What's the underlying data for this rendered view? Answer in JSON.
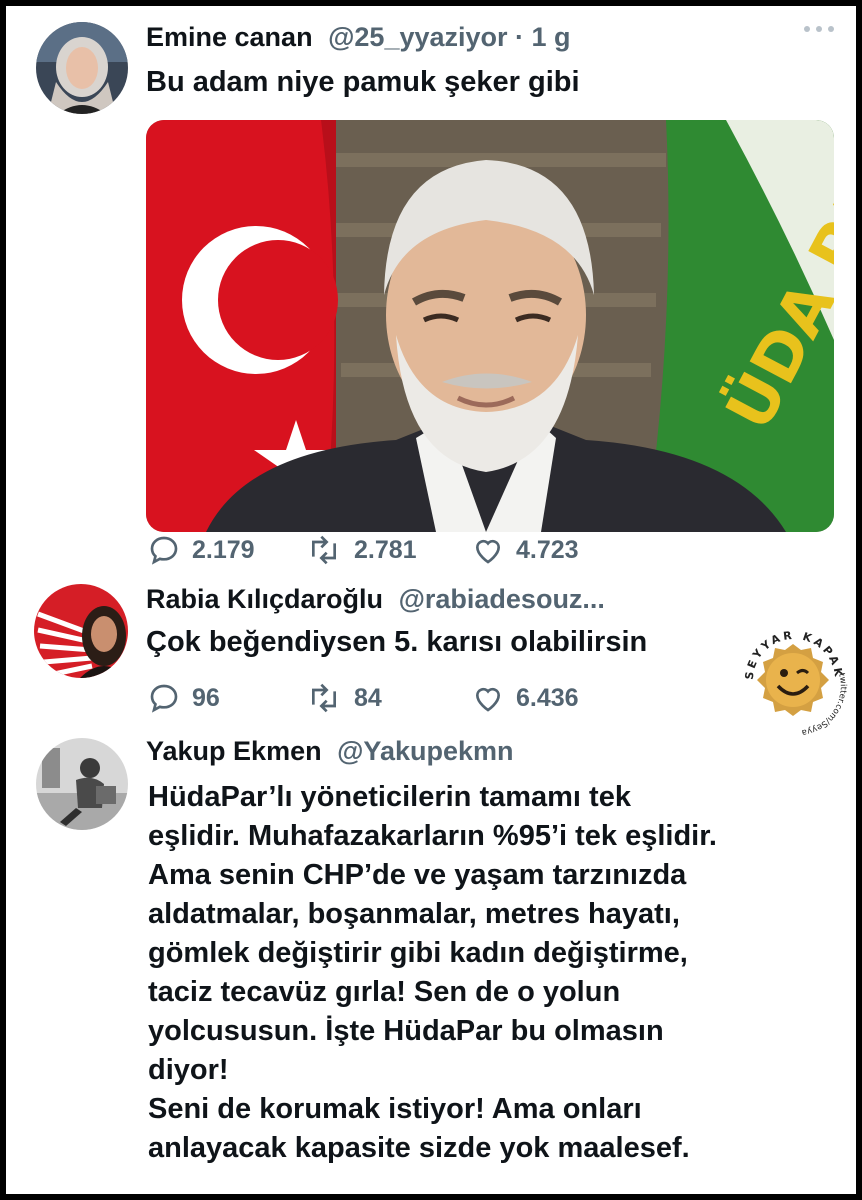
{
  "tweet1": {
    "name": "Emine canan",
    "handle": "@25_yyaziyor",
    "time": "· 1 g",
    "text": "Bu adam niye pamuk şeker gibi",
    "replies": "2.179",
    "retweets": "2.781",
    "likes": "4.723",
    "flag_text": "ÜDA PA"
  },
  "tweet2": {
    "name": "Rabia Kılıçdaroğlu",
    "handle": "@rabiadesouz...",
    "text": "Çok beğendiysen 5. karısı olabilirsin",
    "replies": "96",
    "retweets": "84",
    "likes": "6.436"
  },
  "tweet3": {
    "name": "Yakup Ekmen",
    "handle": "@Yakupekmn",
    "lines": [
      "HüdaPar’lı yöneticilerin tamamı tek",
      "eşlidir. Muhafazakarların %95’i tek eşlidir.",
      "Ama senin CHP’de ve yaşam tarzınızda",
      "aldatmalar, boşanmalar, metres hayatı,",
      "gömlek değiştirir gibi kadın değiştirme,",
      "taciz tecavüz gırla! Sen de o yolun",
      "yolcususun. İşte HüdaPar bu olmasın",
      "diyor!",
      "Seni de korumak istiyor! Ama onları",
      "anlayacak kapasite sizde yok maalesef."
    ]
  },
  "watermark": {
    "arc_text": "SEYYAR KAPAKÇI",
    "url": "twitter.com/SeyyarKapakci"
  },
  "colors": {
    "text": "#0f1419",
    "muted": "#536471",
    "flag_red": "#d8121f",
    "party_green": "#2f8a32",
    "party_yellow": "#e8c21c"
  }
}
